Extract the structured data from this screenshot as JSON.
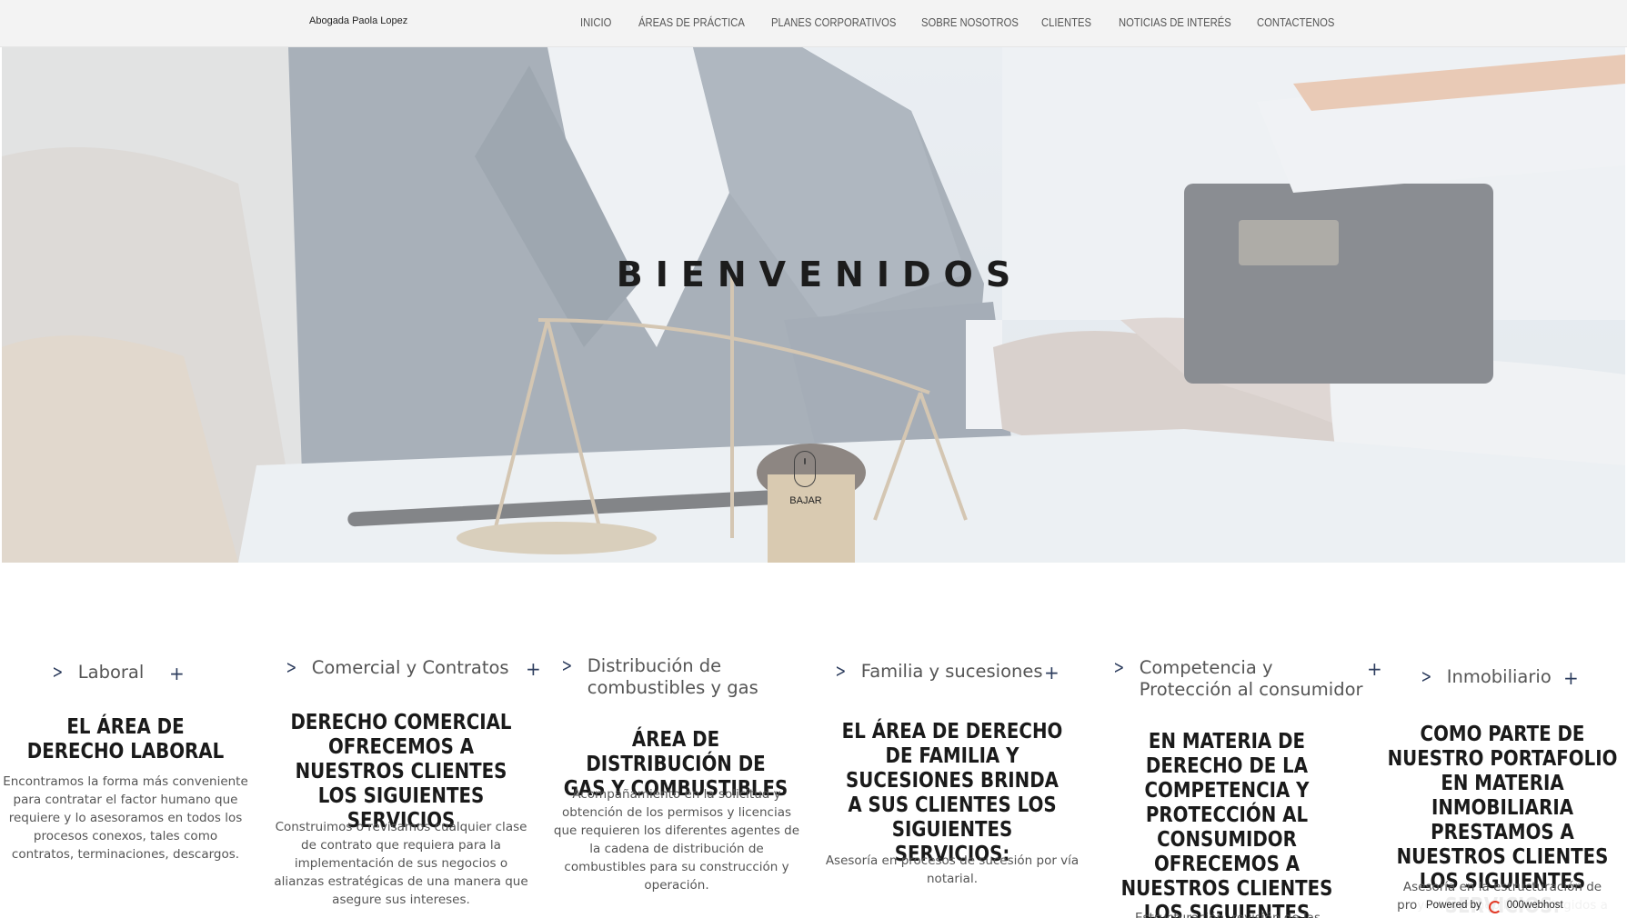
{
  "brand": "Abogada Paola Lopez",
  "nav": {
    "items": [
      "INICIO",
      "ÁREAS DE PRÁCTICA",
      "PLANES CORPORATIVOS",
      "SOBRE NOSOTROS",
      "CLIENTES",
      "NOTICIAS DE INTERÉS",
      "CONTACTENOS"
    ]
  },
  "hero": {
    "title": "BIENVENIDOS",
    "scroll_label": "BAJAR"
  },
  "areas": [
    {
      "label": "Laboral",
      "title": "EL ÁREA DE DERECHO LABORAL",
      "body": "Encontramos la forma más conveniente para contratar el factor humano que requiere y lo asesoramos en todos los procesos conexos, tales como contratos, terminaciones, descargos."
    },
    {
      "label": "Comercial y Contratos",
      "title": "DERECHO COMERCIAL OFRECEMOS A NUESTROS CLIENTES LOS SIGUIENTES SERVICIOS",
      "body": "Construimos o revisamos cualquier clase de contrato que requiera para la implementación de sus negocios o alianzas estratégicas de una manera que asegure sus intereses."
    },
    {
      "label": "Distribución de combustibles y gas",
      "title": "ÁREA DE DISTRIBUCIÓN DE GAS Y COMBUSTIBLES",
      "body": "Acompañamiento en la solicitud y obtención de los permisos y licencias que requieren los diferentes agentes de la cadena de distribución de combustibles para su construcción y operación."
    },
    {
      "label": "Familia y sucesiones",
      "title": "EL ÁREA DE DERECHO DE FAMILIA Y SUCESIONES BRINDA A SUS CLIENTES LOS SIGUIENTES SERVICIOS:",
      "body": "Asesoría en procesos de sucesión por vía notarial."
    },
    {
      "label": "Competencia y Protección al consumidor",
      "title": "EN MATERIA DE DERECHO DE LA COMPETENCIA Y PROTECCIÓN AL CONSUMIDOR OFRECEMOS A NUESTROS CLIENTES LOS SIGUIENTES SERVICIOS:",
      "body": "Estructuración, revisión de las"
    },
    {
      "label": "Inmobiliario",
      "title": "COMO PARTE DE NUESTRO PORTAFOLIO EN MATERIA INMOBILIARIA PRESTAMOS A NUESTROS CLIENTES LOS SIGUIENTES SERVICIOS:",
      "body": "Asesoría en la estructuración de proyectos inmobiliarios dirigidos a"
    }
  ],
  "chevron_glyph": ">",
  "plus_glyph": "+",
  "badge": {
    "prefix": "Powered by",
    "name": "000webhost"
  },
  "colors": {
    "accent": "#2d3d5e",
    "nav_bg": "#f3f3f3",
    "badge_logo": "#e23a27"
  }
}
